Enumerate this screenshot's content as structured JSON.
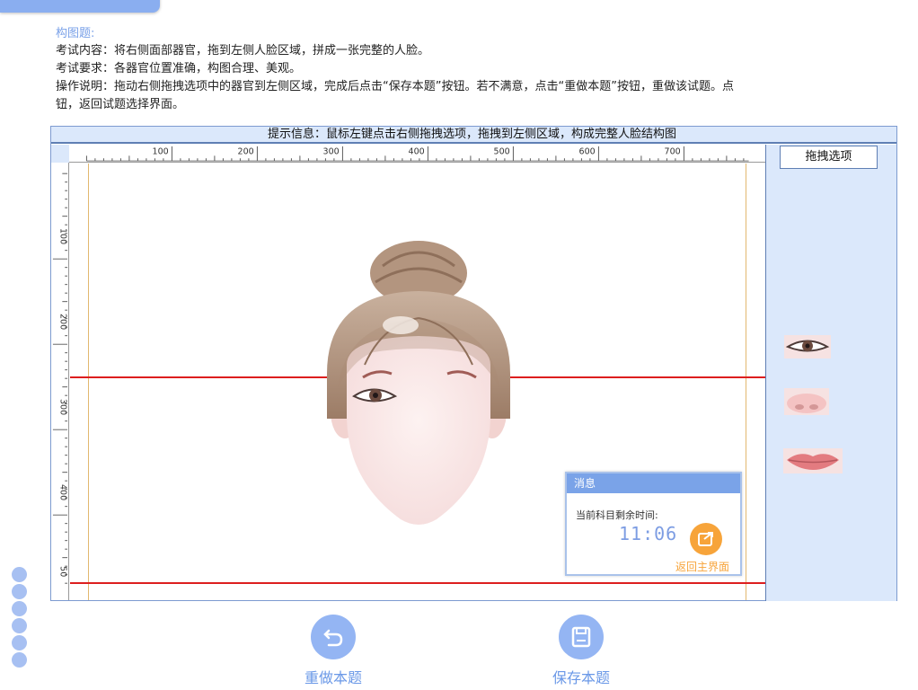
{
  "header": {
    "title": "构图题:",
    "lines": [
      "考试内容：将右侧面部器官，拖到左侧人脸区域，拼成一张完整的人脸。",
      "考试要求：各器官位置准确，构图合理、美观。",
      "操作说明：拖动右侧拖拽选项中的器官到左侧区域，完成后点击“保存本题”按钮。若不满意，点击“重做本题”按钮，重做该试题。点",
      "钮，返回试题选择界面。"
    ]
  },
  "workspace": {
    "hint": "提示信息：鼠标左键点击右侧拖拽选项，拖拽到左侧区域，构成完整人脸结构图"
  },
  "ruler": {
    "top_labels": [
      "100",
      "200",
      "300",
      "400",
      "500",
      "600",
      "700"
    ],
    "left_labels": [
      "100",
      "200",
      "300",
      "400",
      "50"
    ]
  },
  "right_panel": {
    "title": "拖拽选项",
    "items": [
      "eye",
      "nose",
      "mouth"
    ]
  },
  "message": {
    "title": "消息",
    "label": "当前科目剩余时间:",
    "time": "11:06",
    "back_link": "返回主界面",
    "accent_color": "#f7a43a"
  },
  "buttons": {
    "redo_label": "重做本题",
    "save_label": "保存本题",
    "color": "#94b5f3"
  }
}
